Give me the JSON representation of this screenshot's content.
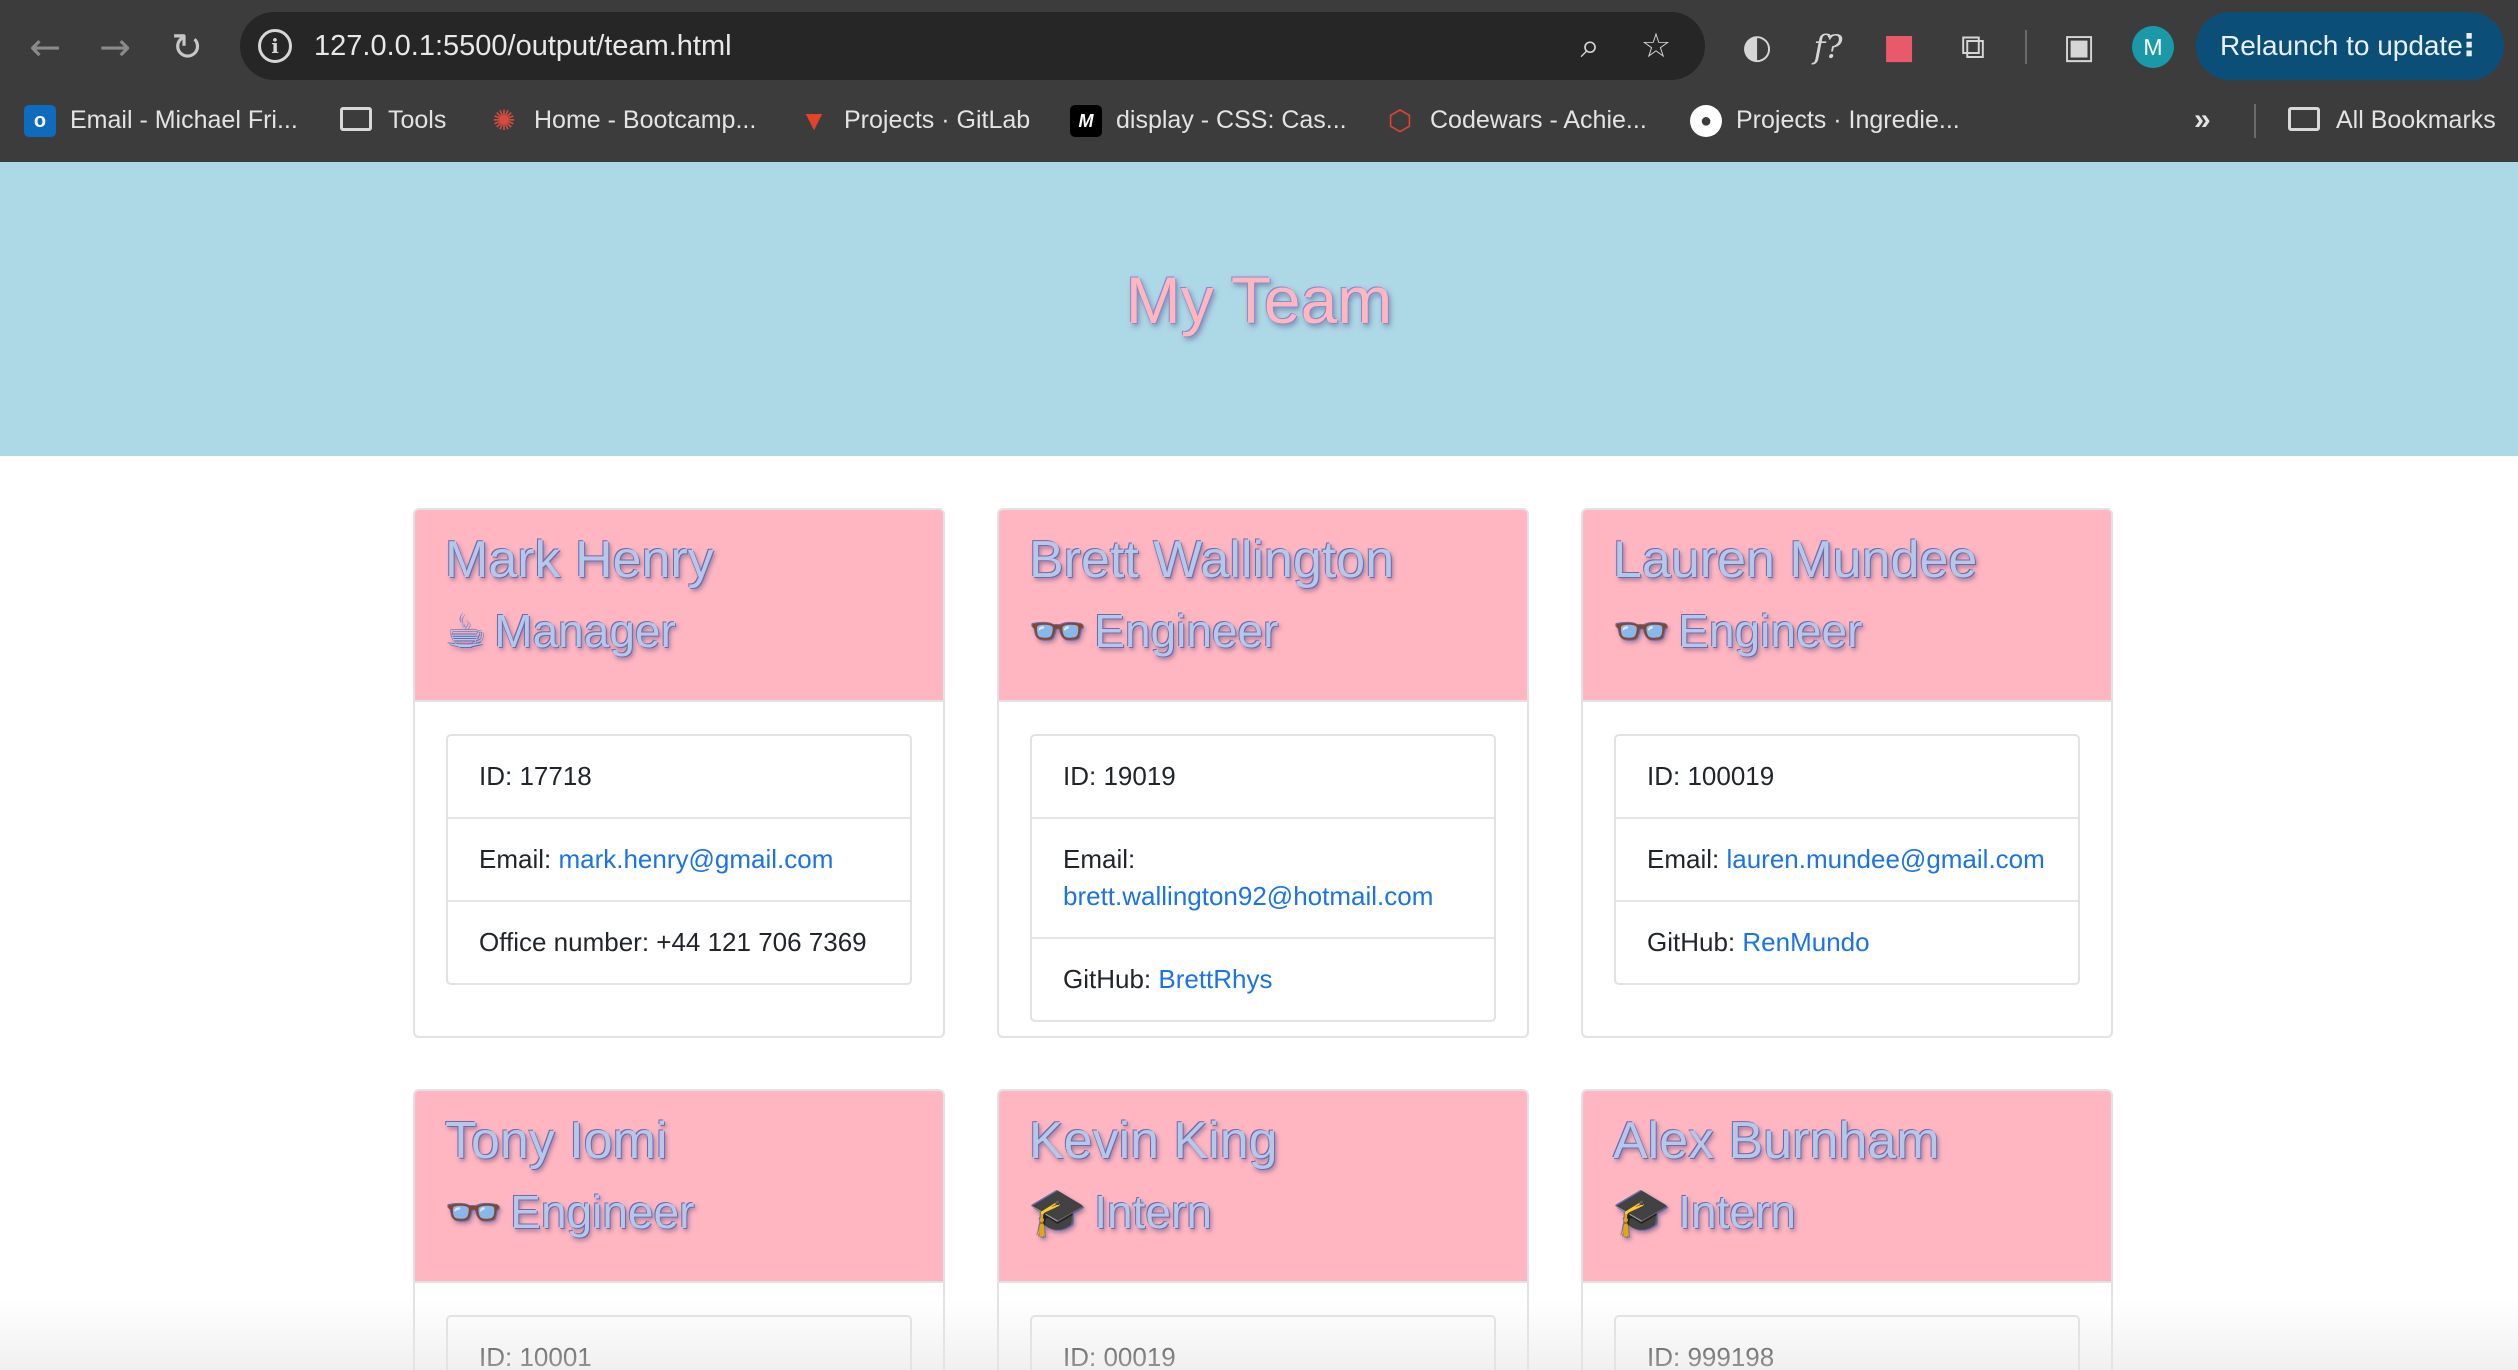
{
  "browser": {
    "url": "127.0.0.1:5500/output/team.html",
    "relaunch_label": "Relaunch to update",
    "relaunch_menu": "⋮",
    "profile_initial": "M",
    "ext_function_label": "f?",
    "overflow_label": "»",
    "bookmarks": [
      {
        "label": "Email - Michael Fri...",
        "icon": "outlook-icon",
        "color": "#0f6cbd"
      },
      {
        "label": "Tools",
        "icon": "folder-icon"
      },
      {
        "label": "Home - Bootcamp...",
        "icon": "bootcamp-icon",
        "color": "#c0392b"
      },
      {
        "label": "Projects · GitLab",
        "icon": "gitlab-icon",
        "color": "#e24329"
      },
      {
        "label": "display - CSS: Cas...",
        "icon": "mdn-icon",
        "color": "#000000"
      },
      {
        "label": "Codewars - Achie...",
        "icon": "codewars-icon",
        "color": "#b1361e"
      },
      {
        "label": "Projects · Ingredie...",
        "icon": "github-icon",
        "color": "#ffffff"
      }
    ],
    "all_bookmarks": "All Bookmarks"
  },
  "page": {
    "title": "My Team",
    "header_bg": "#add8e6",
    "card_head_bg": "#ffb6c1",
    "link_color": "#1a73e8"
  },
  "team": [
    {
      "name": "Mark Henry",
      "role": "Manager",
      "role_icon": "coffee-mug-icon",
      "glyph": "☕",
      "id_label": "ID: ",
      "id": "17718",
      "email_label": "Email: ",
      "email": "mark.henry@gmail.com",
      "extra_label": "Office number: ",
      "extra": "+44 121 706 7369",
      "extra_is_link": false
    },
    {
      "name": "Brett Wallington",
      "role": "Engineer",
      "role_icon": "glasses-icon",
      "glyph": "👓",
      "id_label": "ID: ",
      "id": "19019",
      "email_label": "Email: ",
      "email": "brett.wallington92@hotmail.com",
      "extra_label": "GitHub: ",
      "extra": "BrettRhys",
      "extra_is_link": true
    },
    {
      "name": "Lauren Mundee",
      "role": "Engineer",
      "role_icon": "glasses-icon",
      "glyph": "👓",
      "id_label": "ID: ",
      "id": "100019",
      "email_label": "Email: ",
      "email": "lauren.mundee@gmail.com",
      "extra_label": "GitHub: ",
      "extra": "RenMundo",
      "extra_is_link": true
    },
    {
      "name": "Tony Iomi",
      "role": "Engineer",
      "role_icon": "glasses-icon",
      "glyph": "👓",
      "id_label": "ID: ",
      "id": "10001"
    },
    {
      "name": "Kevin King",
      "role": "Intern",
      "role_icon": "graduate-icon",
      "glyph": "🎓",
      "id_label": "ID: ",
      "id": "00019"
    },
    {
      "name": "Alex Burnham",
      "role": "Intern",
      "role_icon": "graduate-icon",
      "glyph": "🎓",
      "id_label": "ID: ",
      "id": "999198"
    }
  ]
}
